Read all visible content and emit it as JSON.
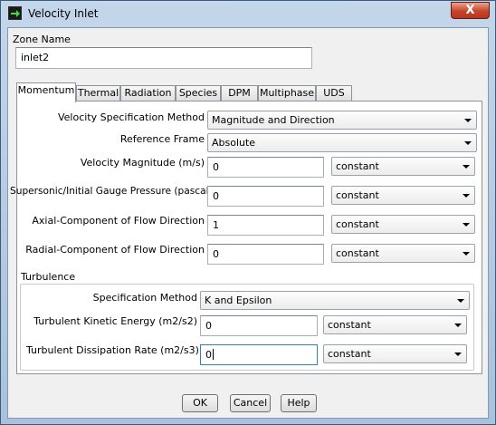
{
  "window": {
    "title": "Velocity Inlet",
    "close_label": "X"
  },
  "zone": {
    "label": "Zone Name",
    "value": "inlet2"
  },
  "tabs": [
    "Momentum",
    "Thermal",
    "Radiation",
    "Species",
    "DPM",
    "Multiphase",
    "UDS"
  ],
  "momentum": {
    "velocity_spec_label": "Velocity Specification Method",
    "velocity_spec_value": "Magnitude and Direction",
    "ref_frame_label": "Reference Frame",
    "ref_frame_value": "Absolute",
    "vel_mag_label": "Velocity Magnitude (m/s)",
    "vel_mag_value": "0",
    "vel_mag_method": "constant",
    "pressure_label": "Supersonic/Initial Gauge Pressure (pascal)",
    "pressure_value": "0",
    "pressure_method": "constant",
    "axial_label": "Axial-Component of Flow Direction",
    "axial_value": "1",
    "axial_method": "constant",
    "radial_label": "Radial-Component of Flow Direction",
    "radial_value": "0",
    "radial_method": "constant"
  },
  "turbulence": {
    "group_label": "Turbulence",
    "spec_label": "Specification Method",
    "spec_value": "K and Epsilon",
    "tke_label": "Turbulent Kinetic Energy (m2/s2)",
    "tke_value": "0",
    "tke_method": "constant",
    "tdr_label": "Turbulent Dissipation Rate (m2/s3)",
    "tdr_value": "0",
    "tdr_method": "constant"
  },
  "buttons": {
    "ok": "OK",
    "cancel": "Cancel",
    "help": "Help"
  }
}
